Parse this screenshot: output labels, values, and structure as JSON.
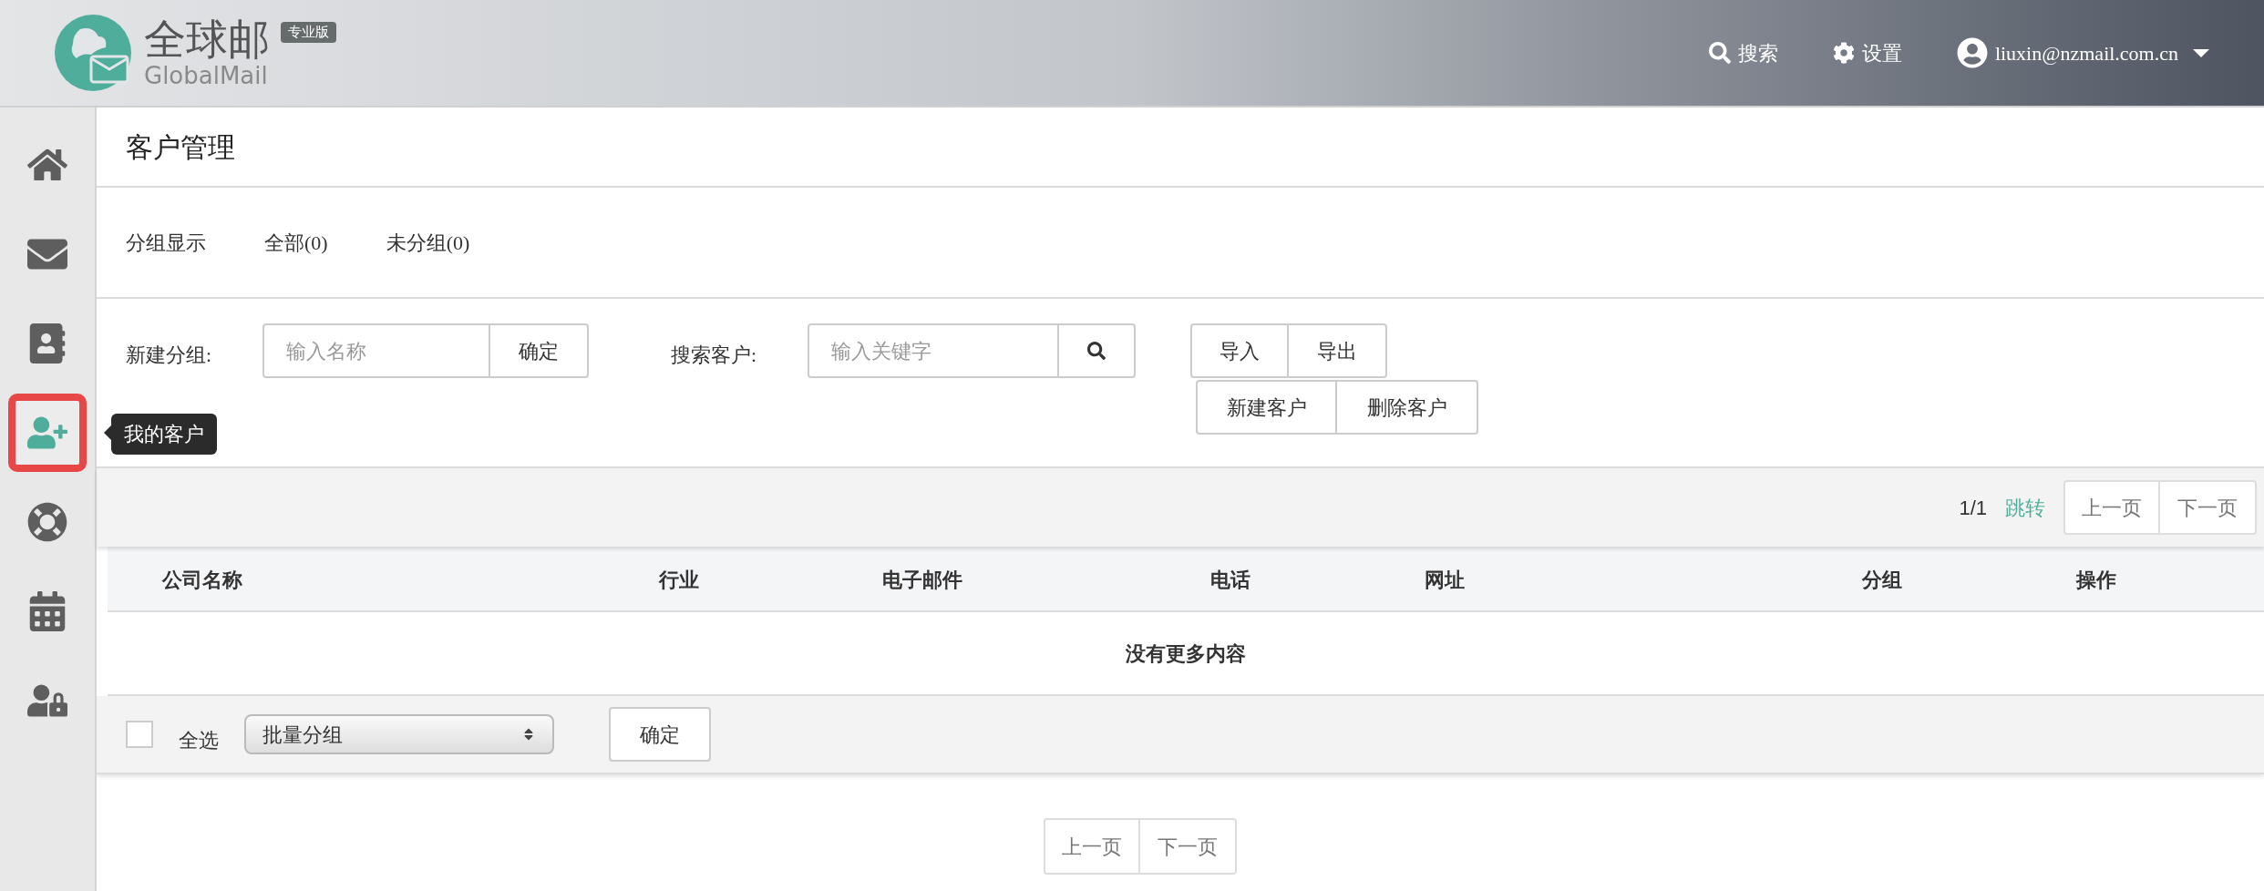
{
  "header": {
    "logo": {
      "name": "全球邮",
      "subtitle": "GlobalMail",
      "badge": "专业版"
    },
    "actions": [
      {
        "kind": "search",
        "label": "搜索"
      },
      {
        "kind": "settings",
        "label": "设置"
      }
    ],
    "user": {
      "email": "liuxin@nzmail.com.cn"
    }
  },
  "sidebar": {
    "items": [
      {
        "kind": "home",
        "selected": false
      },
      {
        "kind": "mail",
        "selected": false
      },
      {
        "kind": "contacts",
        "selected": false
      },
      {
        "kind": "customers",
        "selected": true
      },
      {
        "kind": "lifebuoy",
        "selected": false
      },
      {
        "kind": "calendar",
        "selected": false
      },
      {
        "kind": "user-lock",
        "selected": false
      }
    ],
    "tooltip": "我的客户"
  },
  "page_title": "客户管理",
  "group_filter": {
    "label": "分组显示",
    "items": [
      "全部(0)",
      "未分组(0)"
    ]
  },
  "toolbar": {
    "new_group": {
      "label": "新建分组:",
      "placeholder": "输入名称",
      "button": "确定"
    },
    "search": {
      "label": "搜索客户:",
      "placeholder": "输入关键字"
    },
    "buttons_row_1": [
      "导入",
      "导出"
    ],
    "buttons_row_2": [
      "新建客户",
      "删除客户"
    ]
  },
  "pagination_top": {
    "page": "1/1",
    "jump": "跳转",
    "prev": "上一页",
    "next": "下一页"
  },
  "table": {
    "columns": [
      "公司名称",
      "行业",
      "电子邮件",
      "电话",
      "网址",
      "分组",
      "操作"
    ],
    "empty_message": "没有更多内容"
  },
  "footer": {
    "select_all": {
      "label": "全选",
      "checked": false
    },
    "batch_select": "批量分组",
    "confirm": "确定"
  },
  "pagination_bottom": {
    "prev": "上一页",
    "next": "下一页"
  }
}
